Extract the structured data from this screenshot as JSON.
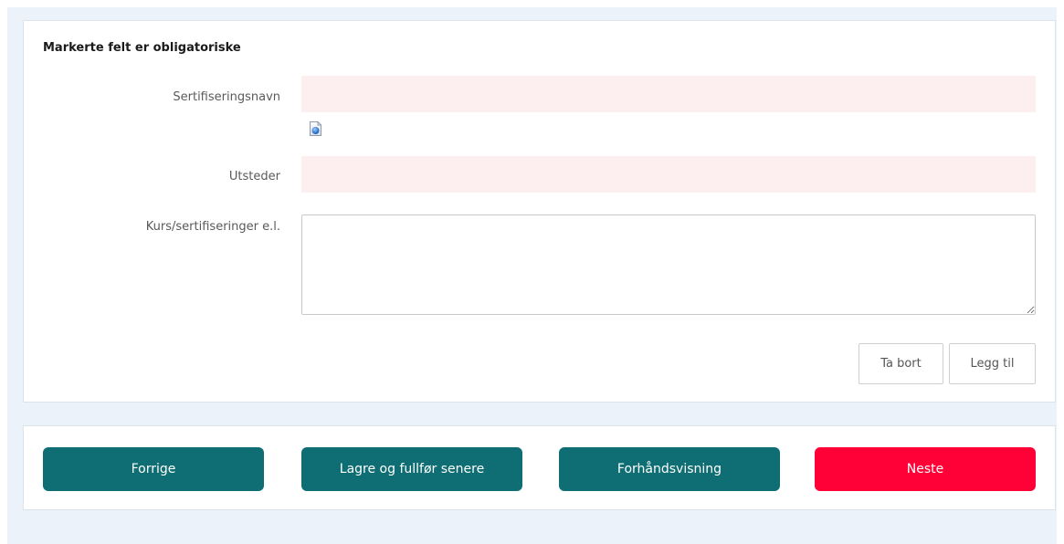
{
  "form": {
    "required_note": "Markerte felt er obligatoriske",
    "fields": {
      "certification_name": {
        "label": "Sertifiseringsnavn",
        "value": ""
      },
      "issuer": {
        "label": "Utsteder",
        "value": ""
      },
      "courses": {
        "label": "Kurs/sertifiseringer e.l.",
        "value": ""
      }
    },
    "help_icon": "info-document-icon",
    "remove_label": "Ta bort",
    "add_label": "Legg til"
  },
  "navigation": {
    "previous_label": "Forrige",
    "save_later_label": "Lagre og fullfør senere",
    "preview_label": "Forhåndsvisning",
    "next_label": "Neste"
  },
  "colors": {
    "page_background": "#ebf2f9",
    "required_field_background": "#fdeff0",
    "secondary_button": "#0f6e73",
    "primary_button": "#ff0037"
  }
}
